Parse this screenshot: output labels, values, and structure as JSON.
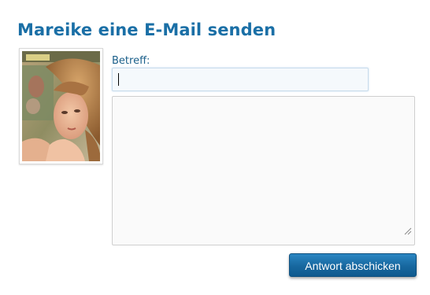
{
  "page": {
    "title": "Mareike eine E-Mail senden"
  },
  "profile": {
    "photo_icon": "profile-photo"
  },
  "form": {
    "subject_label": "Betreff:",
    "subject_value": "",
    "message_value": "",
    "submit_label": "Antwort abschicken"
  },
  "colors": {
    "title": "#1a6fa6",
    "label": "#1a5f8a",
    "button": "#17679f",
    "input_border": "#c9dcec"
  }
}
